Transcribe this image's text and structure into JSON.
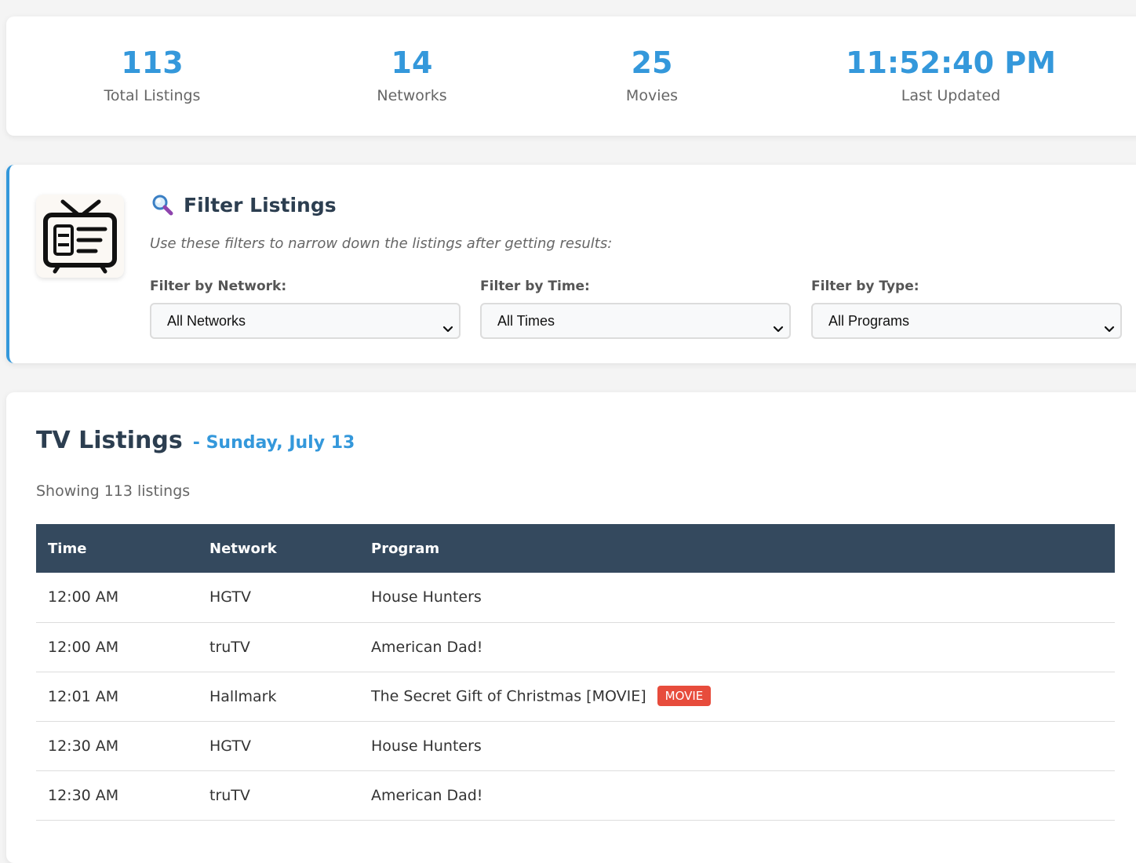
{
  "stats": [
    {
      "value": "113",
      "label": "Total Listings"
    },
    {
      "value": "14",
      "label": "Networks"
    },
    {
      "value": "25",
      "label": "Movies"
    },
    {
      "value": "11:52:40 PM",
      "label": "Last Updated"
    }
  ],
  "filter": {
    "icon": "magnifying-glass-icon",
    "logo_icon": "tv-guide-icon",
    "title": "Filter Listings",
    "description": "Use these filters to narrow down the listings after getting results:",
    "groups": [
      {
        "label": "Filter by Network:",
        "selected": "All Networks"
      },
      {
        "label": "Filter by Time:",
        "selected": "All Times"
      },
      {
        "label": "Filter by Type:",
        "selected": "All Programs"
      }
    ]
  },
  "listings": {
    "title": "TV Listings",
    "date": "- Sunday, July 13",
    "showing": "Showing 113 listings",
    "columns": [
      "Time",
      "Network",
      "Program"
    ],
    "rows": [
      {
        "time": "12:00 AM",
        "network": "HGTV",
        "program": "House Hunters",
        "badge": ""
      },
      {
        "time": "12:00 AM",
        "network": "truTV",
        "program": "American Dad!",
        "badge": ""
      },
      {
        "time": "12:01 AM",
        "network": "Hallmark",
        "program": "The Secret Gift of Christmas [MOVIE]",
        "badge": "MOVIE"
      },
      {
        "time": "12:30 AM",
        "network": "HGTV",
        "program": "House Hunters",
        "badge": ""
      },
      {
        "time": "12:30 AM",
        "network": "truTV",
        "program": "American Dad!",
        "badge": ""
      }
    ]
  },
  "colors": {
    "accent": "#3498db",
    "header_bg": "#34495e",
    "movie_badge": "#e74c3c",
    "text_dark": "#2c3e50"
  }
}
